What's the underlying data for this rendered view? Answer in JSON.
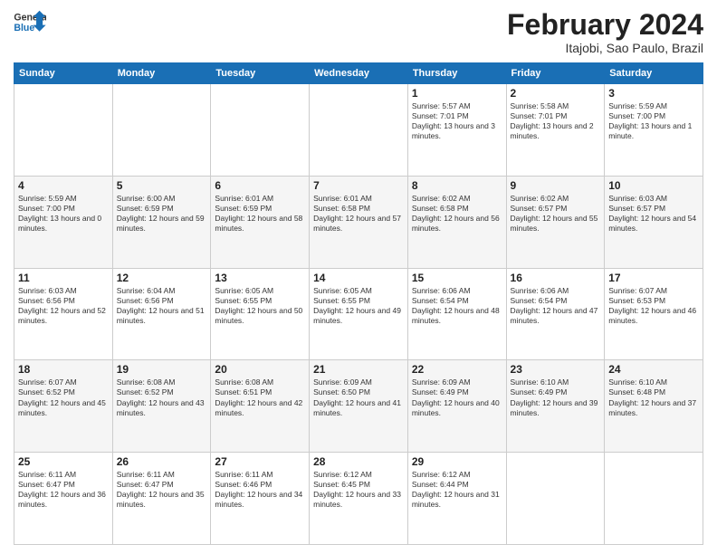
{
  "logo": {
    "general": "General",
    "blue": "Blue"
  },
  "header": {
    "month": "February 2024",
    "location": "Itajobi, Sao Paulo, Brazil"
  },
  "weekdays": [
    "Sunday",
    "Monday",
    "Tuesday",
    "Wednesday",
    "Thursday",
    "Friday",
    "Saturday"
  ],
  "weeks": [
    [
      {
        "day": null
      },
      {
        "day": null
      },
      {
        "day": null
      },
      {
        "day": null
      },
      {
        "day": 1,
        "sunrise": "5:57 AM",
        "sunset": "7:01 PM",
        "daylight": "13 hours and 3 minutes."
      },
      {
        "day": 2,
        "sunrise": "5:58 AM",
        "sunset": "7:01 PM",
        "daylight": "13 hours and 2 minutes."
      },
      {
        "day": 3,
        "sunrise": "5:59 AM",
        "sunset": "7:00 PM",
        "daylight": "13 hours and 1 minute."
      }
    ],
    [
      {
        "day": 4,
        "sunrise": "5:59 AM",
        "sunset": "7:00 PM",
        "daylight": "13 hours and 0 minutes."
      },
      {
        "day": 5,
        "sunrise": "6:00 AM",
        "sunset": "6:59 PM",
        "daylight": "12 hours and 59 minutes."
      },
      {
        "day": 6,
        "sunrise": "6:01 AM",
        "sunset": "6:59 PM",
        "daylight": "12 hours and 58 minutes."
      },
      {
        "day": 7,
        "sunrise": "6:01 AM",
        "sunset": "6:58 PM",
        "daylight": "12 hours and 57 minutes."
      },
      {
        "day": 8,
        "sunrise": "6:02 AM",
        "sunset": "6:58 PM",
        "daylight": "12 hours and 56 minutes."
      },
      {
        "day": 9,
        "sunrise": "6:02 AM",
        "sunset": "6:57 PM",
        "daylight": "12 hours and 55 minutes."
      },
      {
        "day": 10,
        "sunrise": "6:03 AM",
        "sunset": "6:57 PM",
        "daylight": "12 hours and 54 minutes."
      }
    ],
    [
      {
        "day": 11,
        "sunrise": "6:03 AM",
        "sunset": "6:56 PM",
        "daylight": "12 hours and 52 minutes."
      },
      {
        "day": 12,
        "sunrise": "6:04 AM",
        "sunset": "6:56 PM",
        "daylight": "12 hours and 51 minutes."
      },
      {
        "day": 13,
        "sunrise": "6:05 AM",
        "sunset": "6:55 PM",
        "daylight": "12 hours and 50 minutes."
      },
      {
        "day": 14,
        "sunrise": "6:05 AM",
        "sunset": "6:55 PM",
        "daylight": "12 hours and 49 minutes."
      },
      {
        "day": 15,
        "sunrise": "6:06 AM",
        "sunset": "6:54 PM",
        "daylight": "12 hours and 48 minutes."
      },
      {
        "day": 16,
        "sunrise": "6:06 AM",
        "sunset": "6:54 PM",
        "daylight": "12 hours and 47 minutes."
      },
      {
        "day": 17,
        "sunrise": "6:07 AM",
        "sunset": "6:53 PM",
        "daylight": "12 hours and 46 minutes."
      }
    ],
    [
      {
        "day": 18,
        "sunrise": "6:07 AM",
        "sunset": "6:52 PM",
        "daylight": "12 hours and 45 minutes."
      },
      {
        "day": 19,
        "sunrise": "6:08 AM",
        "sunset": "6:52 PM",
        "daylight": "12 hours and 43 minutes."
      },
      {
        "day": 20,
        "sunrise": "6:08 AM",
        "sunset": "6:51 PM",
        "daylight": "12 hours and 42 minutes."
      },
      {
        "day": 21,
        "sunrise": "6:09 AM",
        "sunset": "6:50 PM",
        "daylight": "12 hours and 41 minutes."
      },
      {
        "day": 22,
        "sunrise": "6:09 AM",
        "sunset": "6:49 PM",
        "daylight": "12 hours and 40 minutes."
      },
      {
        "day": 23,
        "sunrise": "6:10 AM",
        "sunset": "6:49 PM",
        "daylight": "12 hours and 39 minutes."
      },
      {
        "day": 24,
        "sunrise": "6:10 AM",
        "sunset": "6:48 PM",
        "daylight": "12 hours and 37 minutes."
      }
    ],
    [
      {
        "day": 25,
        "sunrise": "6:11 AM",
        "sunset": "6:47 PM",
        "daylight": "12 hours and 36 minutes."
      },
      {
        "day": 26,
        "sunrise": "6:11 AM",
        "sunset": "6:47 PM",
        "daylight": "12 hours and 35 minutes."
      },
      {
        "day": 27,
        "sunrise": "6:11 AM",
        "sunset": "6:46 PM",
        "daylight": "12 hours and 34 minutes."
      },
      {
        "day": 28,
        "sunrise": "6:12 AM",
        "sunset": "6:45 PM",
        "daylight": "12 hours and 33 minutes."
      },
      {
        "day": 29,
        "sunrise": "6:12 AM",
        "sunset": "6:44 PM",
        "daylight": "12 hours and 31 minutes."
      },
      {
        "day": null
      },
      {
        "day": null
      }
    ]
  ]
}
